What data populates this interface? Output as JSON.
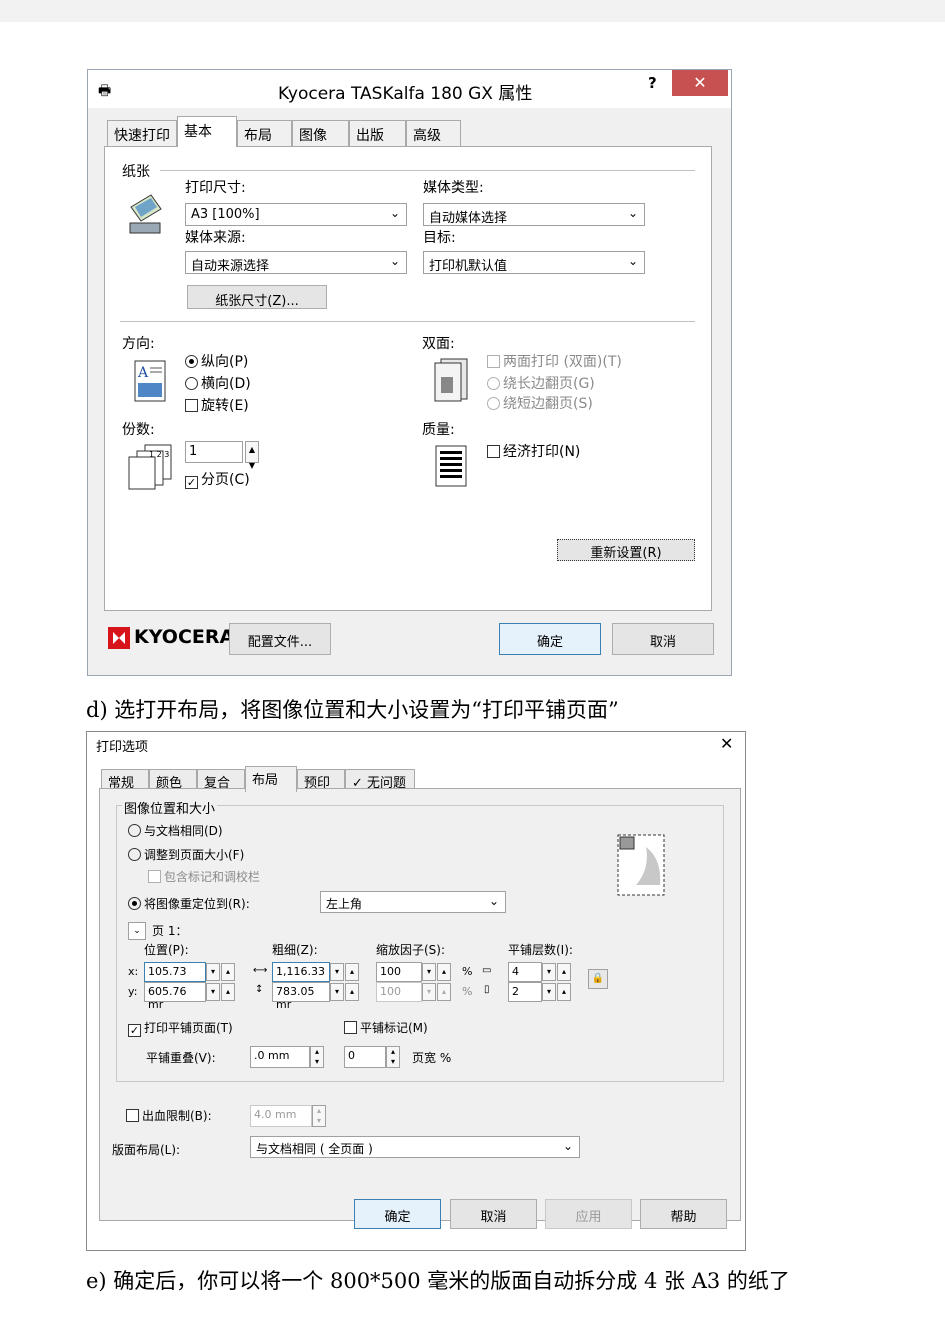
{
  "dialog1": {
    "title": "Kyocera TASKalfa 180 GX 属性",
    "help_glyph": "?",
    "close_glyph": "✕",
    "tabs": [
      "快速打印",
      "基本",
      "布局",
      "图像",
      "出版",
      "高级"
    ],
    "paper_section": "纸张",
    "print_size_label": "打印尺寸:",
    "print_size_value": "A3 [100%]",
    "media_type_label": "媒体类型:",
    "media_type_value": "自动媒体选择",
    "media_source_label": "媒体来源:",
    "media_source_value": "自动来源选择",
    "destination_label": "目标:",
    "destination_value": "打印机默认值",
    "paper_size_button": "纸张尺寸(Z)...",
    "orientation_label": "方向:",
    "portrait": "纵向(P)",
    "landscape": "横向(D)",
    "rotate": "旋转(E)",
    "duplex_label": "双面:",
    "duplex_print": "两面打印 (双面)(T)",
    "long_edge": "绕长边翻页(G)",
    "short_edge": "绕短边翻页(S)",
    "copies_label": "份数:",
    "copies_value": "1",
    "collate": "分页(C)",
    "quality_label": "质量:",
    "eco_print": "经济打印(N)",
    "reset_button": "重新设置(R)",
    "brand": "KYOCERA",
    "profile_button": "配置文件...",
    "ok_button": "确定",
    "cancel_button": "取消"
  },
  "para_d": "d) 选打开布局，将图像位置和大小设置为“打印平铺页面”",
  "dialog2": {
    "title": "打印选项",
    "close_glyph": "✕",
    "tabs": [
      "常规",
      "颜色",
      "复合",
      "布局",
      "预印",
      "无问题"
    ],
    "group_title": "图像位置和大小",
    "same_as_doc": "与文档相同(D)",
    "fit_to_page": "调整到页面大小(F)",
    "include_marks": "包含标记和调校栏",
    "reposition": "将图像重定位到(R):",
    "reposition_value": "左上角",
    "page_label": "页 1：",
    "position_label": "位置(P):",
    "thickness_label": "粗细(Z):",
    "scale_label": "缩放因子(S):",
    "tile_label": "平铺层数(I):",
    "x_label": "x:",
    "y_label": "y:",
    "x_pos": "105.73 mr",
    "y_pos": "605.76 mr",
    "width": "1,116.33 n",
    "height": "783.05 mr",
    "scale_x": "100",
    "scale_y": "100",
    "percent": "%",
    "tile_x": "4",
    "tile_y": "2",
    "print_tiled": "打印平铺页面(T)",
    "tile_marks": "平铺标记(M)",
    "tile_overlap_label": "平铺重叠(V):",
    "tile_overlap_value": ".0 mm",
    "page_width_value": "0",
    "page_width_label": "页宽 %",
    "bleed_label": "出血限制(B):",
    "bleed_value": "4.0 mm",
    "layout_label": "版面布局(L):",
    "layout_value": "与文档相同 ( 全页面 )",
    "ok_button": "确定",
    "cancel_button": "取消",
    "apply_button": "应用",
    "help_button": "帮助"
  },
  "para_e": "e) 确定后，你可以将一个 800*500 毫米的版面自动拆分成 4 张 A3 的纸了"
}
